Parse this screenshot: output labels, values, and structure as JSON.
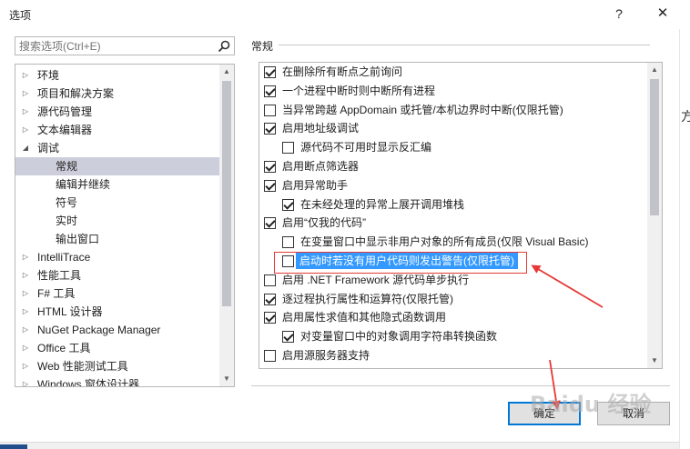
{
  "dialog": {
    "title": "选项",
    "help_glyph": "?",
    "close_glyph": "✕"
  },
  "search": {
    "placeholder": "搜索选项(Ctrl+E)"
  },
  "tree": {
    "items": [
      {
        "label": "环境",
        "expanded": false,
        "level": 0
      },
      {
        "label": "项目和解决方案",
        "expanded": false,
        "level": 0
      },
      {
        "label": "源代码管理",
        "expanded": false,
        "level": 0
      },
      {
        "label": "文本编辑器",
        "expanded": false,
        "level": 0
      },
      {
        "label": "调试",
        "expanded": true,
        "level": 0
      },
      {
        "label": "常规",
        "level": 1,
        "selected": true
      },
      {
        "label": "编辑并继续",
        "level": 1
      },
      {
        "label": "符号",
        "level": 1
      },
      {
        "label": "实时",
        "level": 1
      },
      {
        "label": "输出窗口",
        "level": 1
      },
      {
        "label": "IntelliTrace",
        "expanded": false,
        "level": 0
      },
      {
        "label": "性能工具",
        "expanded": false,
        "level": 0
      },
      {
        "label": "F# 工具",
        "expanded": false,
        "level": 0
      },
      {
        "label": "HTML 设计器",
        "expanded": false,
        "level": 0
      },
      {
        "label": "NuGet Package Manager",
        "expanded": false,
        "level": 0
      },
      {
        "label": "Office 工具",
        "expanded": false,
        "level": 0
      },
      {
        "label": "Web 性能测试工具",
        "expanded": false,
        "level": 0
      },
      {
        "label": "Windows 窗体设计器",
        "expanded": false,
        "level": 0
      }
    ]
  },
  "section": {
    "title": "常规"
  },
  "options": [
    {
      "label": "在删除所有断点之前询问",
      "checked": true,
      "indent": 0
    },
    {
      "label": "一个进程中断时则中断所有进程",
      "checked": true,
      "indent": 0
    },
    {
      "label": "当异常跨越 AppDomain 或托管/本机边界时中断(仅限托管)",
      "checked": false,
      "indent": 0
    },
    {
      "label": "启用地址级调试",
      "checked": true,
      "indent": 0
    },
    {
      "label": "源代码不可用时显示反汇编",
      "checked": false,
      "indent": 1
    },
    {
      "label": "启用断点筛选器",
      "checked": true,
      "indent": 0
    },
    {
      "label": "启用异常助手",
      "checked": true,
      "indent": 0
    },
    {
      "label": "在未经处理的异常上展开调用堆栈",
      "checked": true,
      "indent": 1
    },
    {
      "label": "启用“仅我的代码”",
      "checked": true,
      "indent": 0
    },
    {
      "label": "在变量窗口中显示非用户对象的所有成员(仅限 Visual Basic)",
      "checked": false,
      "indent": 1
    },
    {
      "label": "启动时若没有用户代码则发出警告(仅限托管)",
      "checked": false,
      "indent": 1,
      "highlighted": true
    },
    {
      "label": "启用 .NET Framework 源代码单步执行",
      "checked": false,
      "indent": 0
    },
    {
      "label": "逐过程执行属性和运算符(仅限托管)",
      "checked": true,
      "indent": 0
    },
    {
      "label": "启用属性求值和其他隐式函数调用",
      "checked": true,
      "indent": 0
    },
    {
      "label": "对变量窗口中的对象调用字符串转换函数",
      "checked": true,
      "indent": 1
    },
    {
      "label": "启用源服务器支持",
      "checked": false,
      "indent": 0
    }
  ],
  "buttons": {
    "ok": "确定",
    "cancel": "取消"
  },
  "outside": {
    "char": "方"
  },
  "watermark": {
    "text": "Baidu 经验"
  },
  "colors": {
    "selection": "#3399ff",
    "annotation": "#e53935",
    "tree_selected": "#cccedb",
    "default_button": "#0078d7"
  }
}
